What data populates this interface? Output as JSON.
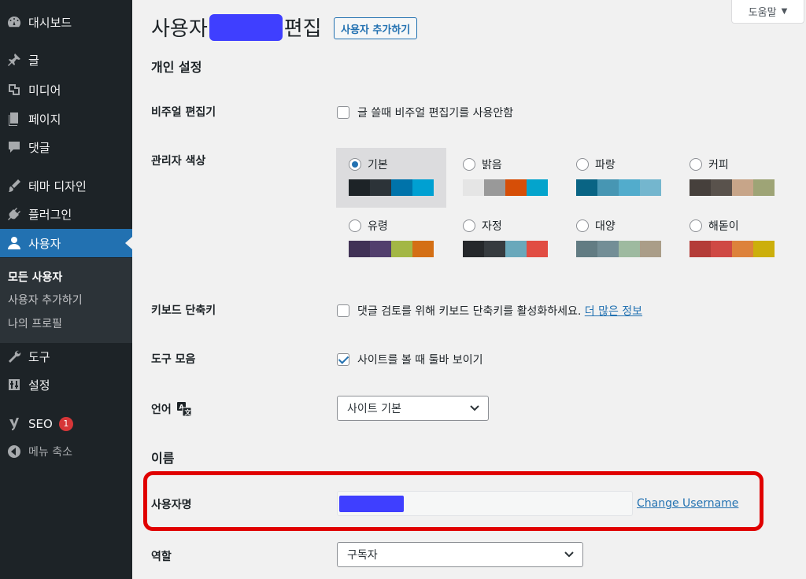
{
  "sidebar": {
    "items": [
      {
        "label": "대시보드",
        "icon": "dashboard-icon"
      },
      {
        "label": "글",
        "icon": "pin-icon"
      },
      {
        "label": "미디어",
        "icon": "media-icon"
      },
      {
        "label": "페이지",
        "icon": "page-icon"
      },
      {
        "label": "댓글",
        "icon": "comment-icon"
      },
      {
        "label": "테마 디자인",
        "icon": "brush-icon"
      },
      {
        "label": "플러그인",
        "icon": "plugin-icon"
      },
      {
        "label": "사용자",
        "icon": "user-icon"
      },
      {
        "label": "도구",
        "icon": "wrench-icon"
      },
      {
        "label": "설정",
        "icon": "settings-icon"
      },
      {
        "label": "SEO",
        "icon": "yoast-icon",
        "badge": "1"
      },
      {
        "label": "메뉴 축소",
        "icon": "collapse-icon"
      }
    ],
    "submenu": [
      "모든 사용자",
      "사용자 추가하기",
      "나의 프로필"
    ]
  },
  "help_tab": {
    "label": "도움말"
  },
  "header": {
    "title_prefix": "사용자",
    "title_suffix": "편집",
    "add_new_label": "사용자 추가하기"
  },
  "personal": {
    "section_title": "개인 설정",
    "visual_editor_label": "비주얼 편집기",
    "visual_editor_text": "글 쓸때 비주얼 편집기를 사용안함",
    "admin_color_label": "관리자 색상",
    "schemes": [
      {
        "name": "기본",
        "colors": [
          "#1d2327",
          "#2c3338",
          "#2271b1",
          "#72aee6"
        ]
      },
      {
        "name": "밝음",
        "colors": [
          "#e5e5e5",
          "#999999",
          "#d64e07",
          "#04a4cc"
        ]
      },
      {
        "name": "파랑",
        "colors": [
          "#096484",
          "#4796b3",
          "#52accc",
          "#74b6ce"
        ]
      },
      {
        "name": "커피",
        "colors": [
          "#46403c",
          "#59524c",
          "#c7a589",
          "#9ea476"
        ]
      },
      {
        "name": "유령",
        "colors": [
          "#413256",
          "#523f6d",
          "#a3b745",
          "#d46f15"
        ]
      },
      {
        "name": "자정",
        "colors": [
          "#25282b",
          "#363b3f",
          "#69a8bb",
          "#e14d43"
        ]
      },
      {
        "name": "대양",
        "colors": [
          "#627c83",
          "#738e96",
          "#9ebaa0",
          "#aa9d88"
        ]
      },
      {
        "name": "해돋이",
        "colors": [
          "#b43c38",
          "#cf4944",
          "#dd823b",
          "#ccaf0b"
        ]
      }
    ],
    "keyboard_label": "키보드 단축키",
    "keyboard_text": "댓글 검토를 위해 키보드 단축키를 활성화하세요.",
    "keyboard_link": "더 많은 정보",
    "toolbar_label": "도구 모음",
    "toolbar_text": "사이트를 볼 때 툴바 보이기",
    "language_label": "언어",
    "language_value": "사이트 기본"
  },
  "name": {
    "section_title": "이름",
    "username_label": "사용자명",
    "change_username": "Change Username",
    "role_label": "역할",
    "role_value": "구독자"
  }
}
